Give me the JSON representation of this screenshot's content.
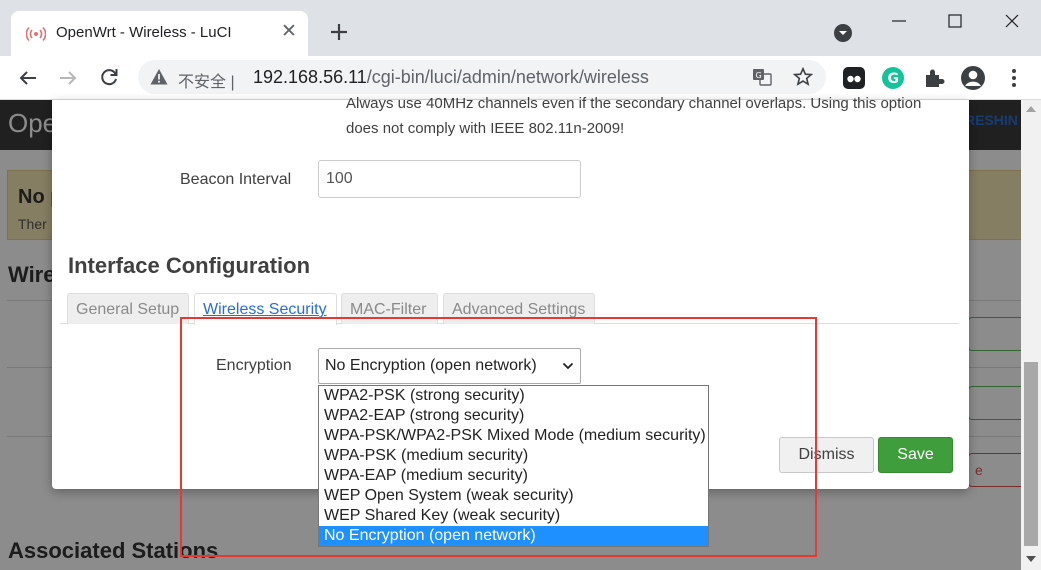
{
  "browser": {
    "tab_title": "OpenWrt - Wireless - LuCI",
    "security_label": "不安全",
    "url_host": "192.168.56.11",
    "url_path": "/cgi-bin/luci/admin/network/wireless"
  },
  "background": {
    "brand": "Ope",
    "refresh_label": "RESHIN",
    "alert_title": "No p",
    "alert_text": "Ther",
    "wireless_title": "Wire",
    "delete_label": "e",
    "associated_title": "Associated Stations"
  },
  "modal": {
    "description": "Always use 40MHz channels even if the secondary channel overlaps. Using this option does not comply with IEEE 802.11n-2009!",
    "beacon_label": "Beacon Interval",
    "beacon_value": "100",
    "section_title": "Interface Configuration",
    "tabs": [
      {
        "label": "General Setup",
        "active": false
      },
      {
        "label": "Wireless Security",
        "active": true
      },
      {
        "label": "MAC-Filter",
        "active": false
      },
      {
        "label": "Advanced Settings",
        "active": false
      }
    ],
    "encryption_label": "Encryption",
    "encryption_selected": "No Encryption (open network)",
    "dismiss_label": "Dismiss",
    "save_label": "Save"
  },
  "dropdown": {
    "options": [
      "WPA2-PSK (strong security)",
      "WPA2-EAP (strong security)",
      "WPA-PSK/WPA2-PSK Mixed Mode (medium security)",
      "WPA-PSK (medium security)",
      "WPA-EAP (medium security)",
      "WEP Open System (weak security)",
      "WEP Shared Key (weak security)",
      "No Encryption (open network)"
    ],
    "selected_index": 7
  },
  "colors": {
    "accent": "#2a6ecf",
    "save": "#3f9d3b",
    "selected_option": "#1e90ff",
    "highlight": "#e53935"
  }
}
